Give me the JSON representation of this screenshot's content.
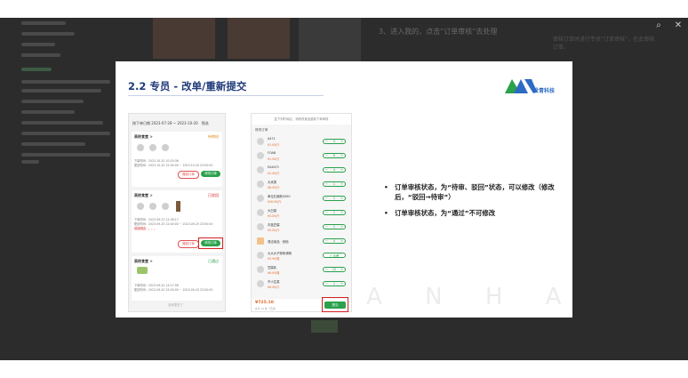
{
  "viewer": {
    "icons": [
      "search-icon",
      "close-icon"
    ],
    "search_glyph": "⌕",
    "close_glyph": "✕"
  },
  "background_doc": {
    "step_text": "3、进入我的，点击“订单审核”去处理",
    "note_text": "审核订单时进行专员“订单审核”，在此审核订单。"
  },
  "slide": {
    "title": "2.2 专员 - 改单/重新提交",
    "logo_text": "爱青科技",
    "watermark": "S U A N   H A I   K E J I",
    "accent_color": "#1f3a7a",
    "highlight_color": "#d32020",
    "green": "#2aa14c"
  },
  "phone_list": {
    "filter_date": "按下单日期 2023-07-28 ~ 2023-10-20",
    "filter_btn": "筛选",
    "orders": [
      {
        "shop": "高校食堂 >",
        "status": "待审核",
        "status_color": "#e08a1e",
        "time1": "下单时间：2023-10-20 10:20:36",
        "time2": "配送时间：2023-10-20 22:00:00 ~ 2023-10-20 23:00:00",
        "btn_a": "撤回订单",
        "btn_b": "修改订单"
      },
      {
        "shop": "高校食堂 >",
        "status": "已驳回",
        "status_color": "#d32020",
        "time1": "下单时间：2023-09-23 14:38:17",
        "time2": "配送时间：2023-09-25 22:00:00 ~ 2023-09-25 23:00:00",
        "reason": "驳回原因：。。。",
        "btn_a": "撤回订单",
        "btn_b": "修改订单"
      },
      {
        "shop": "高校食堂 >",
        "status": "已通过",
        "status_color": "#2aa14c",
        "time1": "下单时间：2023-09-20 14:17:08",
        "time2": "配送时间：2023-09-20 22:00:00 ~ 2023-09-20 23:00:00"
      }
    ],
    "end_text": "没有更多了"
  },
  "phone_edit": {
    "header": "复下列时间后，请修改食品重新下单审核",
    "section": "修改订单",
    "items": [
      {
        "name": "A471",
        "price": "¥1.00/斤",
        "qty": "4"
      },
      {
        "name": "FOAB",
        "price": "¥1.00/斤",
        "qty": "6"
      },
      {
        "name": "EA4471",
        "price": "¥1.00/斤",
        "qty": "4"
      },
      {
        "name": "大米类",
        "price": "¥8.00/斤",
        "qty": "1"
      },
      {
        "name": "单位红面粉3450",
        "price": "¥16.00/斤",
        "qty": "1"
      },
      {
        "name": "大白菜",
        "price": "¥3.00/斤",
        "qty": "1"
      },
      {
        "name": "中蓝豆腐",
        "price": "¥5.00/斤",
        "qty": "1"
      },
      {
        "name": "清洁用品 · 其他",
        "price": "",
        "qty": "4"
      },
      {
        "name": "大大大子蒜粉调味",
        "price": "¥3.90/瓶",
        "qty": "0"
      },
      {
        "name": "豆腐乳",
        "price": "¥6.00/瓶",
        "qty": "12"
      },
      {
        "name": "不小生菜",
        "price": "¥6.00/斤",
        "qty": "1"
      }
    ],
    "add_btn_label": "+ 加餐",
    "total": "¥725.10",
    "total_sub": "共计 12 件（已选）",
    "submit": "提交"
  },
  "bullets": [
    "订单审核状态，为“待审、驳回”状态，可以修改（修改后，“驳回→待审”）",
    "订单审核状态，为“通过”不可修改"
  ]
}
